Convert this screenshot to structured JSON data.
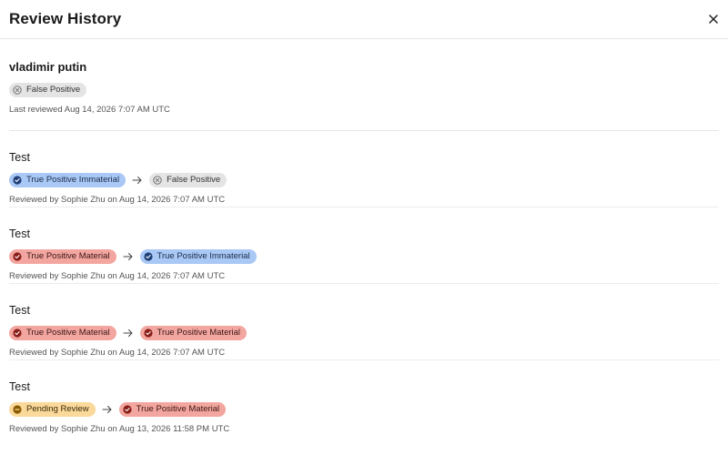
{
  "header": {
    "title": "Review History"
  },
  "summary": {
    "name": "vladimir putin",
    "status": {
      "label": "False Positive",
      "kind": "fp"
    },
    "last_reviewed": "Last reviewed Aug 14, 2026 7:07 AM UTC"
  },
  "history": [
    {
      "title": "Test",
      "from": {
        "label": "True Positive Immaterial",
        "kind": "tpi"
      },
      "to": {
        "label": "False Positive",
        "kind": "fp"
      },
      "meta": "Reviewed by Sophie Zhu on Aug 14, 2026 7:07 AM UTC"
    },
    {
      "title": "Test",
      "from": {
        "label": "True Positive Material",
        "kind": "tpm"
      },
      "to": {
        "label": "True Positive Immaterial",
        "kind": "tpi"
      },
      "meta": "Reviewed by Sophie Zhu on Aug 14, 2026 7:07 AM UTC"
    },
    {
      "title": "Test",
      "from": {
        "label": "True Positive Material",
        "kind": "tpm"
      },
      "to": {
        "label": "True Positive Material",
        "kind": "tpm"
      },
      "meta": "Reviewed by Sophie Zhu on Aug 14, 2026 7:07 AM UTC"
    },
    {
      "title": "Test",
      "from": {
        "label": "Pending Review",
        "kind": "pr"
      },
      "to": {
        "label": "True Positive Material",
        "kind": "tpm"
      },
      "meta": "Reviewed by Sophie Zhu on Aug 13, 2026 11:58 PM UTC"
    }
  ],
  "colors": {
    "false_positive_bg": "#e4e4e4",
    "tp_immaterial_bg": "#a9c8f5",
    "tp_material_bg": "#f3a6a0",
    "pending_bg": "#fbd99a"
  }
}
